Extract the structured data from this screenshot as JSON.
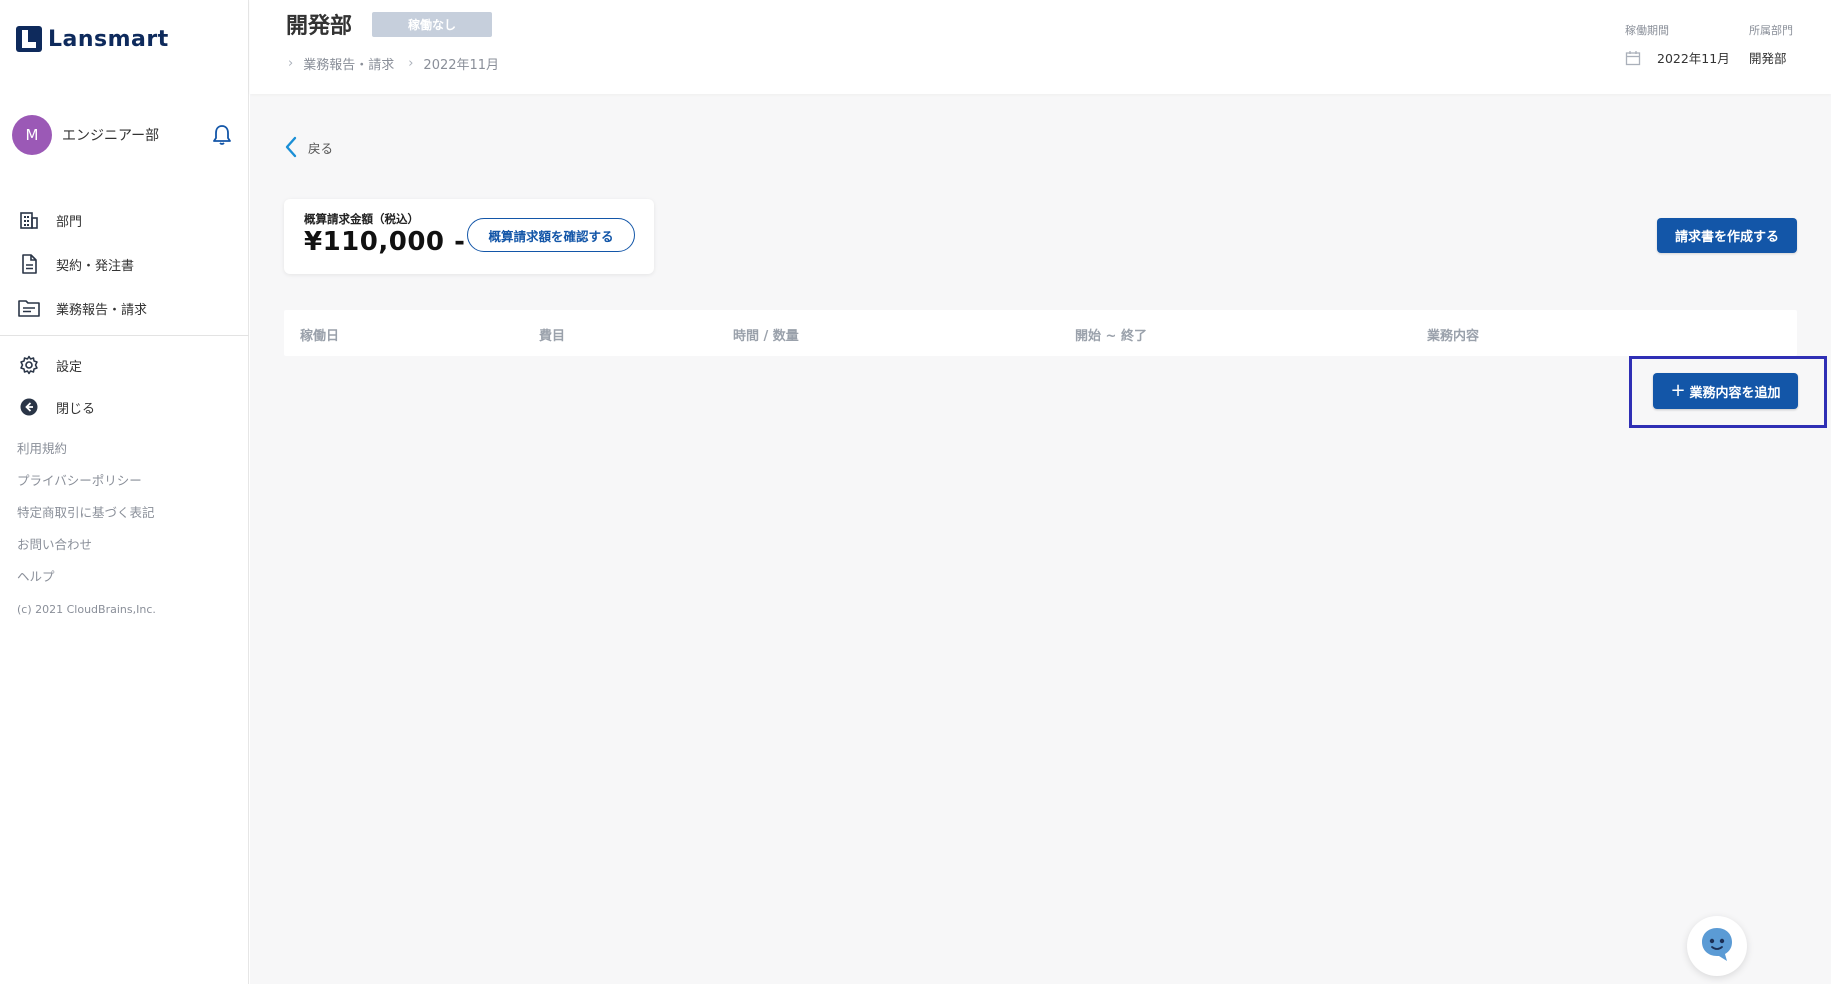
{
  "brand": {
    "name": "Lansmart"
  },
  "user": {
    "initial": "M",
    "name": "エンジニアー部"
  },
  "nav": [
    {
      "label": "部門",
      "icon": "building-icon"
    },
    {
      "label": "契約・発注書",
      "icon": "document-icon"
    },
    {
      "label": "業務報告・請求",
      "icon": "folder-icon"
    }
  ],
  "nav_secondary": [
    {
      "label": "設定",
      "icon": "gear-icon"
    },
    {
      "label": "閉じる",
      "icon": "arrow-left-circle-icon"
    }
  ],
  "footer_links": [
    "利用規約",
    "プライバシーポリシー",
    "特定商取引に基づく表記",
    "お問い合わせ",
    "ヘルプ"
  ],
  "copyright": "(c) 2021 CloudBrains,Inc.",
  "header": {
    "title": "開発部",
    "status_badge": "稼働なし",
    "breadcrumb": [
      "業務報告・請求",
      "2022年11月"
    ],
    "meta": {
      "period_label": "稼働期間",
      "department_label": "所属部門",
      "period_value": "2022年11月",
      "department_value": "開発部"
    }
  },
  "back_label": "戻る",
  "summary": {
    "label": "概算請求金額（税込）",
    "amount": "¥110,000 -",
    "confirm_button": "概算請求額を確認する"
  },
  "create_invoice_button": "請求書を作成する",
  "table": {
    "columns": [
      "稼働日",
      "費目",
      "時間 / 数量",
      "開始 ~ 終了",
      "業務内容"
    ]
  },
  "add_button": "業務内容を追加",
  "colors": {
    "primary": "#1356a8",
    "brand": "#0e2a5c",
    "avatar": "#9b59b6",
    "highlight_border": "#2f2fb5",
    "badge": "#c6cfdc"
  }
}
